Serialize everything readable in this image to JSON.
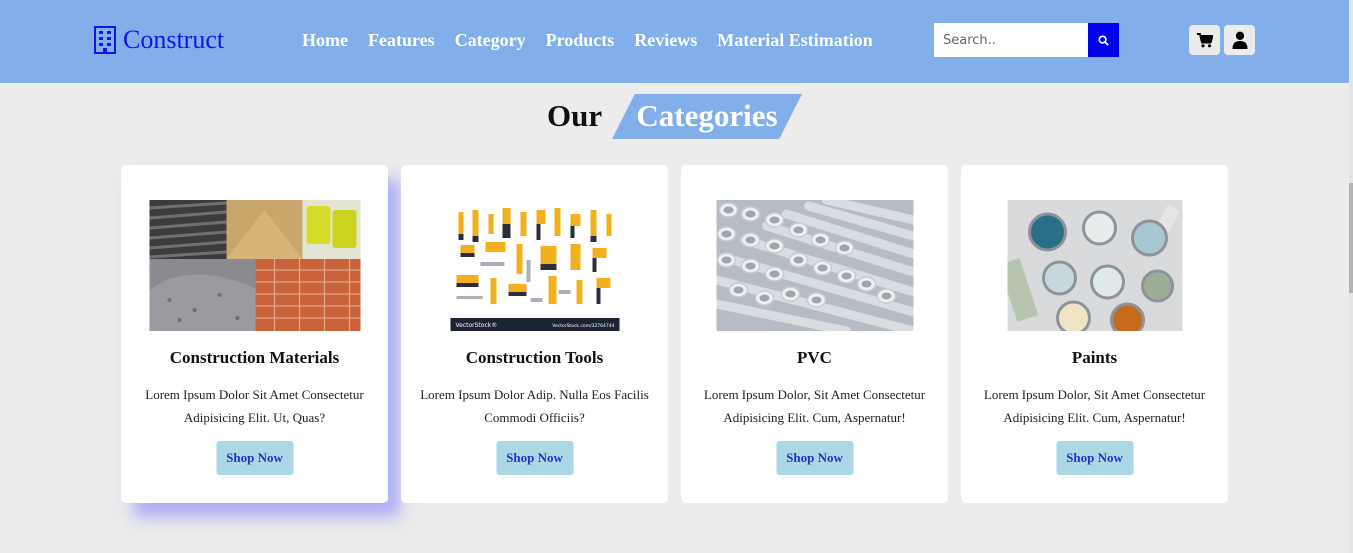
{
  "header": {
    "logo": {
      "icon": "building-icon",
      "text": "Construct",
      "color": "#1414e6"
    },
    "nav": [
      "Home",
      "Features",
      "Category",
      "Products",
      "Reviews",
      "Material Estimation"
    ],
    "search": {
      "placeholder": "Search..",
      "icon": "search-icon"
    },
    "cart_icon": "cart-icon",
    "user_icon": "user-icon",
    "background": "#82aeea"
  },
  "section": {
    "title_plain": "Our",
    "title_highlight": "Categories"
  },
  "categories": [
    {
      "title": "Construction Materials",
      "line1": "Lorem Ipsum Dolor Sit Amet Consectetur",
      "line2": "Adipisicing Elit. Ut, Quas?",
      "button": "Shop Now",
      "image": "construction-materials-image"
    },
    {
      "title": "Construction Tools",
      "line1": "Lorem Ipsum Dolor Adip. Nulla Eos Facilis",
      "line2": "Commodi Officiis?",
      "button": "Shop Now",
      "image": "construction-tools-image",
      "image_caption_left": "VectorStock®",
      "image_caption_right": "VectorStock.com/32764744"
    },
    {
      "title": "PVC",
      "line1": "Lorem Ipsum Dolor, Sit Amet Consectetur",
      "line2": "Adipisicing Elit. Cum, Aspernatur!",
      "button": "Shop Now",
      "image": "pvc-pipes-image"
    },
    {
      "title": "Paints",
      "line1": "Lorem Ipsum Dolor, Sit Amet Consectetur",
      "line2": "Adipisicing Elit. Cum, Aspernatur!",
      "button": "Shop Now",
      "image": "paint-cans-image"
    }
  ]
}
